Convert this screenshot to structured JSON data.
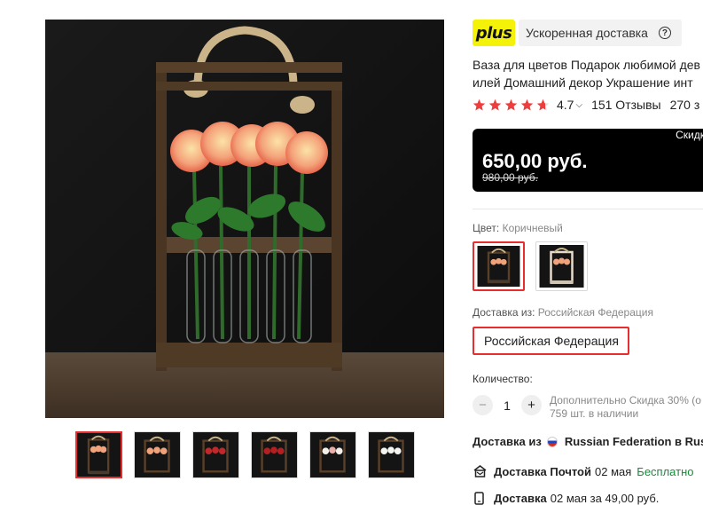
{
  "gallery": {
    "main_image": "wooden-flower-vase-with-roses",
    "thumbnails": [
      "thumb-1",
      "thumb-2",
      "thumb-3",
      "thumb-4",
      "thumb-5",
      "thumb-6"
    ],
    "active_thumbnail": 1
  },
  "badge": {
    "logo": "plus",
    "label": "Ускоренная доставка",
    "help_icon": "question-circle-icon",
    "logo_color": "#f5f20a"
  },
  "product": {
    "title_line1": "Ваза для цветов Подарок любимой дев",
    "title_line2": "илей Домашний декор Украшение инт"
  },
  "rating": {
    "value": "4.7",
    "stars": 4.7,
    "reviews": "151 Отзывы",
    "orders": "270 з",
    "star_color": "#ee3d3d"
  },
  "price": {
    "discount_label": "Скидк",
    "current": "650,00 руб.",
    "old": "980,00 руб."
  },
  "color": {
    "label": "Цвет:",
    "value": "Коричневый",
    "options": [
      "dark-brown-frame",
      "white-wash-frame"
    ],
    "selected": 0
  },
  "shipping": {
    "label": "Доставка из:",
    "value": "Российская Федерация",
    "option": "Российская Федерация"
  },
  "quantity": {
    "label": "Количество:",
    "minus": "−",
    "value": "1",
    "plus": "+",
    "note_line1": "Дополнительно Скидка 30% (о",
    "note_line2": "759 шт. в наличии"
  },
  "delivery": {
    "from_label": "Доставка из",
    "from_country": "Russian Federation в Russ",
    "post_title": "Доставка Почтой",
    "post_date": "02 мая",
    "post_price": "Бесплатно",
    "courier_title": "Доставка",
    "courier_info": "02 мая за 49,00 руб."
  },
  "accent_color": "#e62e2e"
}
